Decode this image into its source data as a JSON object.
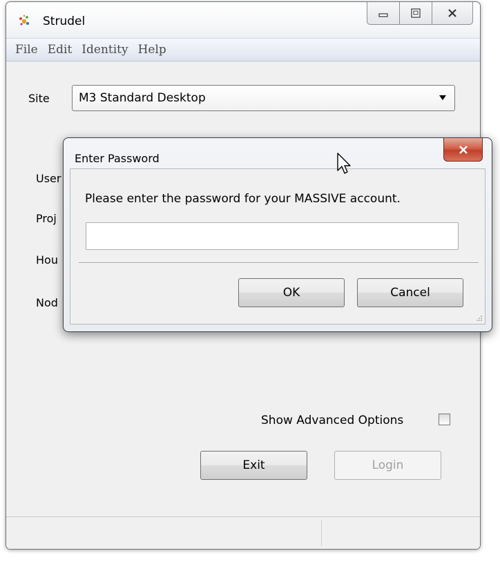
{
  "window": {
    "title": "Strudel",
    "caption_buttons": [
      "minimize",
      "maximize",
      "close"
    ]
  },
  "menu": {
    "items": [
      "File",
      "Edit",
      "Identity",
      "Help"
    ]
  },
  "form": {
    "site_label": "Site",
    "site_value": "M3 Standard Desktop",
    "partial_labels": [
      "User",
      "Proj",
      "Hou",
      "Nod"
    ],
    "show_advanced_label": "Show Advanced Options",
    "show_advanced_checked": false,
    "exit_label": "Exit",
    "login_label": "Login",
    "login_enabled": false
  },
  "dialog": {
    "title": "Enter Password",
    "message": "Please enter the password for your MASSIVE account.",
    "password_value": "",
    "ok_label": "OK",
    "cancel_label": "Cancel"
  },
  "icons": {
    "app": "strudel-app-icon",
    "dialog_close": "close-icon",
    "cursor": "mouse-pointer-icon"
  },
  "colors": {
    "menubar": "#dde4ef",
    "dialog_close": "#c1402a",
    "window_bg": "#f0f0f0"
  }
}
